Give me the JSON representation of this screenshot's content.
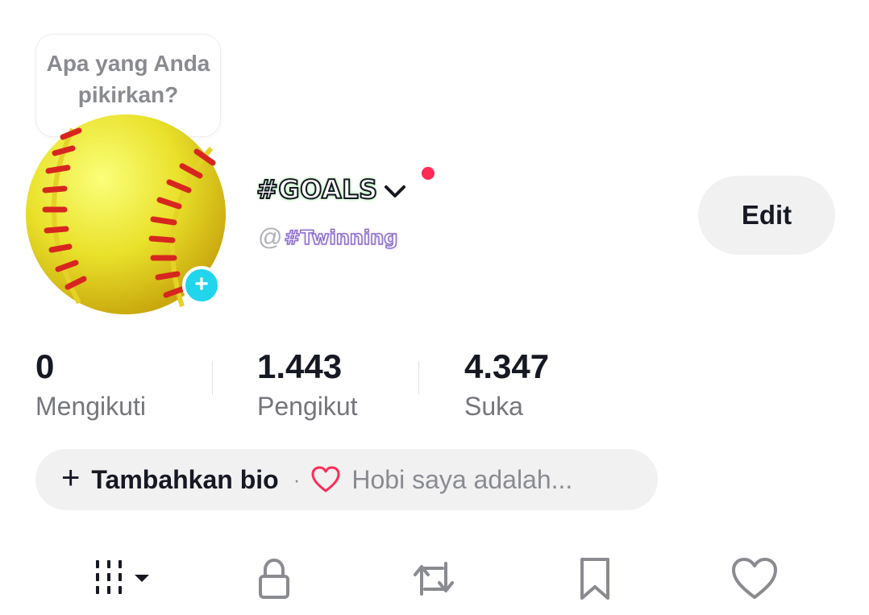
{
  "thought_bubble": {
    "text": "Apa yang Anda pikirkan?"
  },
  "profile": {
    "avatar": "softball-avatar",
    "avatar_add_icon": "plus-icon",
    "display_name": "#GOALS",
    "username_prefix": "@",
    "username_sticker": "#Twinning"
  },
  "actions": {
    "edit_label": "Edit"
  },
  "stats": [
    {
      "value": "0",
      "label": "Mengikuti"
    },
    {
      "value": "1.443",
      "label": "Pengikut"
    },
    {
      "value": "4.347",
      "label": "Suka"
    }
  ],
  "bio": {
    "plus_symbol": "+",
    "add_label": "Tambahkan bio",
    "separator": "·",
    "hint_icon": "heart-outline-icon",
    "hint_text": "Hobi saya adalah..."
  },
  "tabs": [
    {
      "icon": "grid-videos-icon",
      "active": true
    },
    {
      "icon": "lock-icon",
      "active": false
    },
    {
      "icon": "repost-icon",
      "active": false
    },
    {
      "icon": "bookmark-icon",
      "active": false
    },
    {
      "icon": "heart-icon",
      "active": false
    }
  ],
  "colors": {
    "accent_red": "#fe2c55",
    "plus_badge": "#20d5ec",
    "pill_bg": "#f1f1f2",
    "muted_text": "#75767c"
  }
}
